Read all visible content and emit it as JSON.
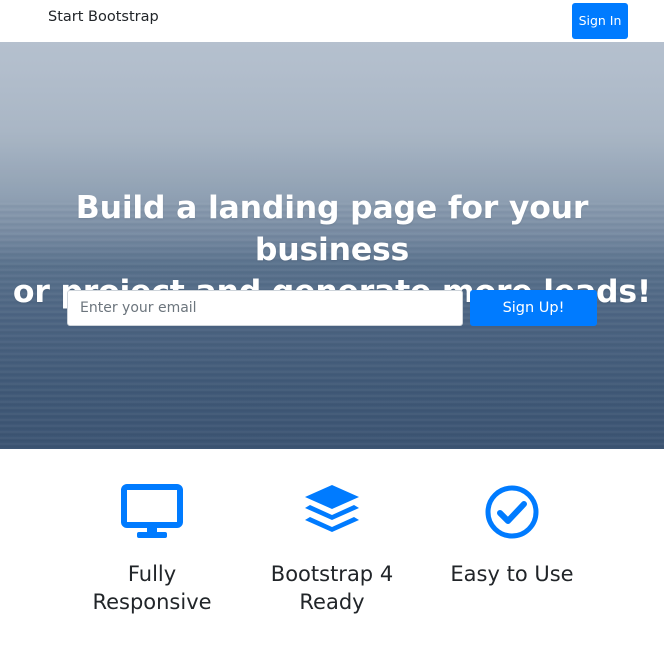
{
  "navbar": {
    "brand": "Start Bootstrap",
    "signin_label": "Sign In"
  },
  "masthead": {
    "headline_line1": "Build a landing page for your business",
    "headline_line2": "or project and generate more leads!",
    "email_placeholder": "Enter your email",
    "signup_label": "Sign Up!"
  },
  "features": [
    {
      "icon": "desktop-monitor-icon",
      "line1": "Fully",
      "line2": "Responsive"
    },
    {
      "icon": "layers-stack-icon",
      "line1": "Bootstrap 4",
      "line2": "Ready"
    },
    {
      "icon": "check-circle-icon",
      "line1": "Easy to Use",
      "line2": ""
    }
  ],
  "colors": {
    "primary": "#007bff",
    "text": "#212529",
    "white": "#ffffff"
  }
}
